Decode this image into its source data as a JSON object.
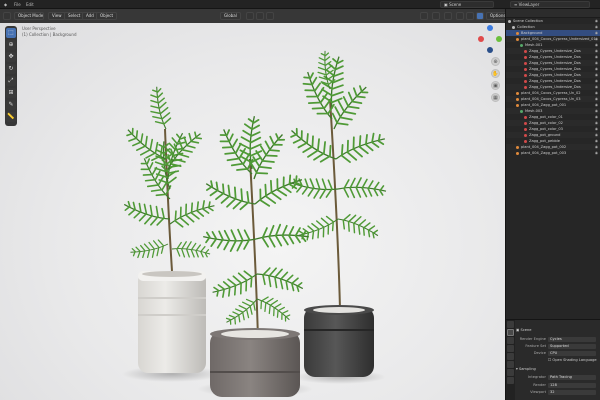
{
  "topbar": {
    "scene": "Scene",
    "view_layer": "ViewLayer",
    "mode_label": "Object Mode",
    "menus": [
      "View",
      "Select",
      "Add",
      "Object"
    ],
    "orientation": "Global",
    "options_label": "Options"
  },
  "viewport": {
    "info_lines": [
      "User Perspective",
      "(1) Collection | Background"
    ]
  },
  "outliner": {
    "title": "Scene Collection",
    "items": [
      {
        "label": "Scene Collection",
        "indent": 0,
        "color": "#bbbbbb"
      },
      {
        "label": "Collection",
        "indent": 1,
        "color": "#bbbbbb"
      },
      {
        "label": "Background",
        "indent": 2,
        "color": "#e08a3c",
        "selected": true
      },
      {
        "label": "plant_004_Cocos_Cypress_Undersized_01",
        "indent": 2,
        "color": "#e08a3c"
      },
      {
        "label": "Mesh.001",
        "indent": 3,
        "color": "#56a86a"
      },
      {
        "label": "Zagg_Cypres_Undersize_Dos",
        "indent": 4,
        "color": "#d24a4a"
      },
      {
        "label": "Zagg_Cypres_Undersize_Dos",
        "indent": 4,
        "color": "#d24a4a"
      },
      {
        "label": "Zagg_Cypres_Undersize_Dos",
        "indent": 4,
        "color": "#d24a4a"
      },
      {
        "label": "Zagg_Cypres_Undersize_Dos",
        "indent": 4,
        "color": "#d24a4a"
      },
      {
        "label": "Zagg_Cypres_Undersize_Dos",
        "indent": 4,
        "color": "#d24a4a"
      },
      {
        "label": "Zagg_Cypres_Undersize_Dos",
        "indent": 4,
        "color": "#d24a4a"
      },
      {
        "label": "Zagg_Cypres_Undersize_Dos",
        "indent": 4,
        "color": "#d24a4a"
      },
      {
        "label": "plant_004_Cocos_Cypress_Un_02",
        "indent": 2,
        "color": "#e08a3c"
      },
      {
        "label": "plant_004_Cocos_Cypress_Un_03",
        "indent": 2,
        "color": "#e08a3c"
      },
      {
        "label": "plant_004_Zagg_pot_001",
        "indent": 2,
        "color": "#e08a3c"
      },
      {
        "label": "Mesh.003",
        "indent": 3,
        "color": "#56a86a"
      },
      {
        "label": "Zagg_pot_color_01",
        "indent": 4,
        "color": "#d24a4a"
      },
      {
        "label": "Zagg_pot_color_02",
        "indent": 4,
        "color": "#d24a4a"
      },
      {
        "label": "Zagg_pot_color_03",
        "indent": 4,
        "color": "#d24a4a"
      },
      {
        "label": "Zagg_pot_ground",
        "indent": 4,
        "color": "#d24a4a"
      },
      {
        "label": "Zagg_pot_pebble",
        "indent": 4,
        "color": "#d24a4a"
      },
      {
        "label": "plant_004_Zagg_pot_002",
        "indent": 2,
        "color": "#e08a3c"
      },
      {
        "label": "plant_004_Zagg_pot_003",
        "indent": 2,
        "color": "#e08a3c"
      }
    ]
  },
  "properties": {
    "section": "Scene",
    "rows": [
      {
        "label": "Render Engine",
        "value": "Cycles"
      },
      {
        "label": "Feature Set",
        "value": "Supported"
      },
      {
        "label": "Device",
        "value": "CPU"
      }
    ],
    "osl": "Open Shading Language",
    "sampling": "Sampling",
    "integrator": {
      "label": "Integrator",
      "value": "Path Tracing"
    },
    "render": {
      "label": "Render",
      "value": "128"
    },
    "viewport_s": {
      "label": "Viewport",
      "value": "32"
    }
  },
  "colors": {
    "accent": "#4772b3",
    "selection": "#334d80"
  }
}
